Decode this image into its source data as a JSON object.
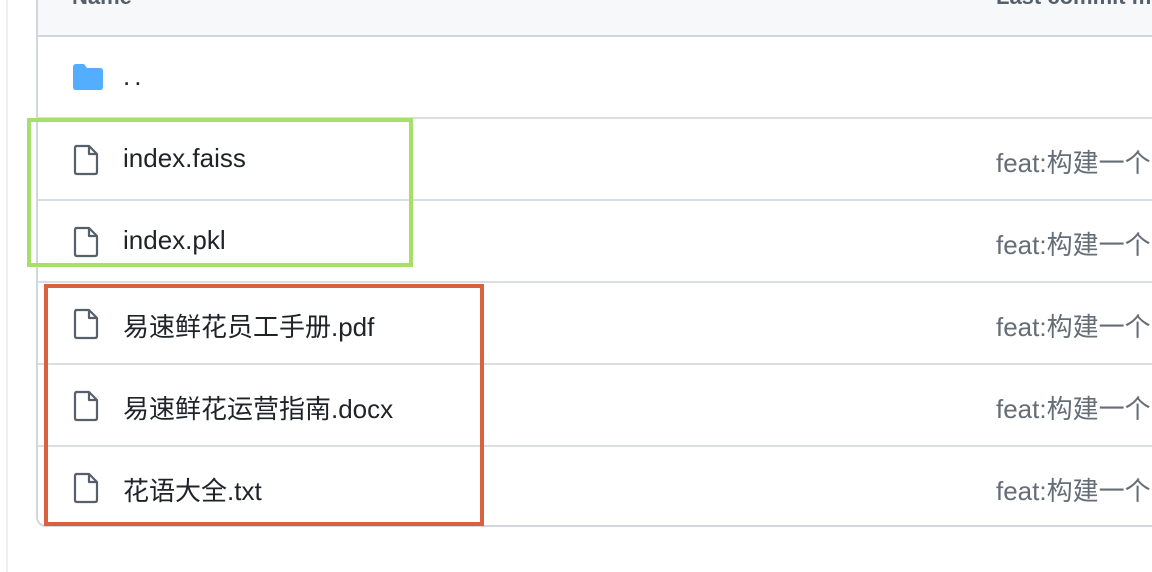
{
  "table": {
    "header": {
      "name_label": "Name",
      "commit_label": "Last commit message"
    },
    "parent_row": {
      "name": "..",
      "icon": "folder-icon"
    },
    "files": [
      {
        "name": "index.faiss",
        "commit": "feat:构建一个",
        "icon": "file-icon"
      },
      {
        "name": "index.pkl",
        "commit": "feat:构建一个",
        "icon": "file-icon"
      },
      {
        "name": "易速鲜花员工手册.pdf",
        "commit": "feat:构建一个",
        "icon": "file-icon"
      },
      {
        "name": "易速鲜花运营指南.docx",
        "commit": "feat:构建一个",
        "icon": "file-icon"
      },
      {
        "name": "花语大全.txt",
        "commit": "feat:构建一个",
        "icon": "file-icon"
      }
    ]
  },
  "annotations": {
    "group_1_color": "#a6e06a",
    "group_2_color": "#d9613f"
  },
  "colors": {
    "folder": "#54aeff",
    "file_icon": "#57606a",
    "border": "#d0d7de",
    "text": "#1f2328",
    "muted": "#656d76"
  }
}
